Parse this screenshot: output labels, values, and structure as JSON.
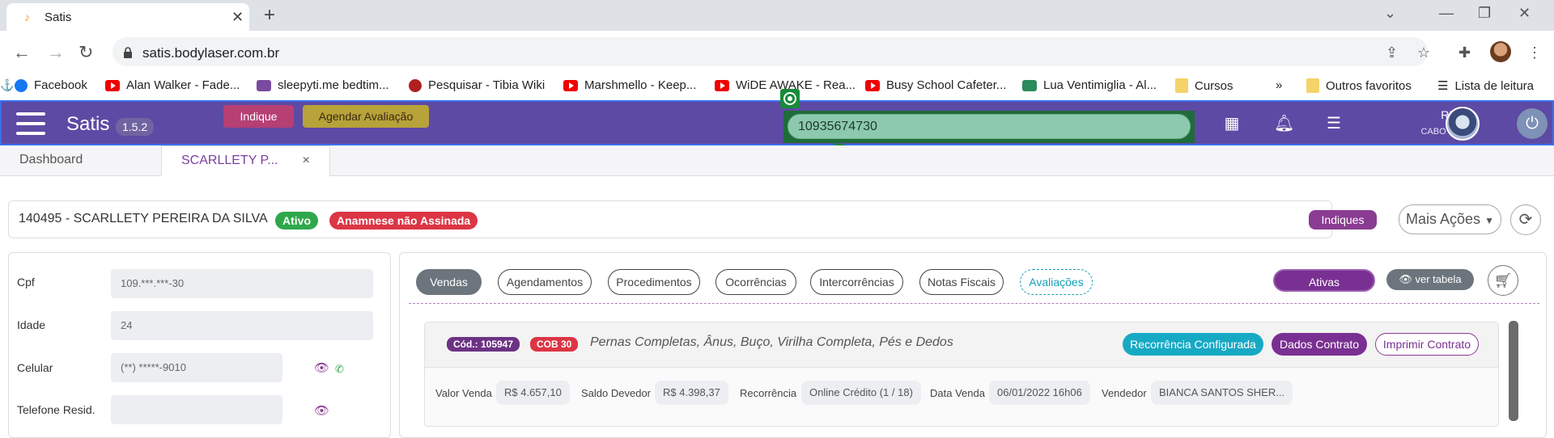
{
  "browser": {
    "tab_title": "Satis",
    "url": "satis.bodylaser.com.br",
    "bookmarks": [
      "Facebook",
      "Alan Walker - Fade...",
      "sleepyti.me bedtim...",
      "Pesquisar - Tibia Wiki",
      "Marshmello - Keep...",
      "WiDE AWAKE - Rea...",
      "Busy School Cafeter...",
      "Lua Ventimiglia - Al...",
      "Cursos",
      "»",
      "Outros favoritos",
      "Lista de leitura"
    ]
  },
  "header": {
    "brand": "Satis",
    "version": "1.5.2",
    "indique": "Indique",
    "agendar": "Agendar Avaliação",
    "search_value": "10935674730",
    "user": "RPA",
    "city": "CABO FRIO"
  },
  "tabs": {
    "dashboard": "Dashboard",
    "client": "SCARLLETY P...",
    "close": "×"
  },
  "client": {
    "name": "140495 - SCARLLETY PEREIRA DA SILVA",
    "status": "Ativo",
    "anamnese": "Anamnese não Assinada",
    "indiques": "Indiques",
    "mais_acoes": "Mais Ações"
  },
  "profile": {
    "cpf_label": "Cpf",
    "cpf": "109.***.***-30",
    "idade_label": "Idade",
    "idade": "24",
    "celular_label": "Celular",
    "celular": "(**) *****-9010",
    "telefone_label": "Telefone Resid.",
    "telefone": ""
  },
  "section_tabs": [
    "Vendas",
    "Agendamentos",
    "Procedimentos",
    "Ocorrências",
    "Intercorrências",
    "Notas Fiscais",
    "Avaliações"
  ],
  "filters": {
    "ativas": "Ativas",
    "ver_tabela": "ver tabela"
  },
  "contract": {
    "cod": "Cód.: 105947",
    "cob": "COB 30",
    "description": "Pernas Completas, Ânus, Buço, Virilha Completa, Pés e Dedos",
    "recorrencia_btn": "Recorrência Configurada",
    "dados_btn": "Dados Contrato",
    "imprimir_btn": "Imprimir Contrato",
    "valor_label": "Valor Venda",
    "valor": "R$ 4.657,10",
    "saldo_label": "Saldo Devedor",
    "saldo": "R$ 4.398,37",
    "recorr_label": "Recorrência",
    "recorr": "Online Crédito (1 / 18)",
    "data_label": "Data Venda",
    "data": "06/01/2022 16h06",
    "vendedor_label": "Vendedor",
    "vendedor": "BIANCA SANTOS SHER..."
  },
  "colors": {
    "header_bg": "#5d4aa4",
    "accent_purple": "#7a3092",
    "search_bg": "#8cc9ae",
    "danger": "#dc3545",
    "success": "#2ea84b",
    "info": "#17a9c4"
  }
}
